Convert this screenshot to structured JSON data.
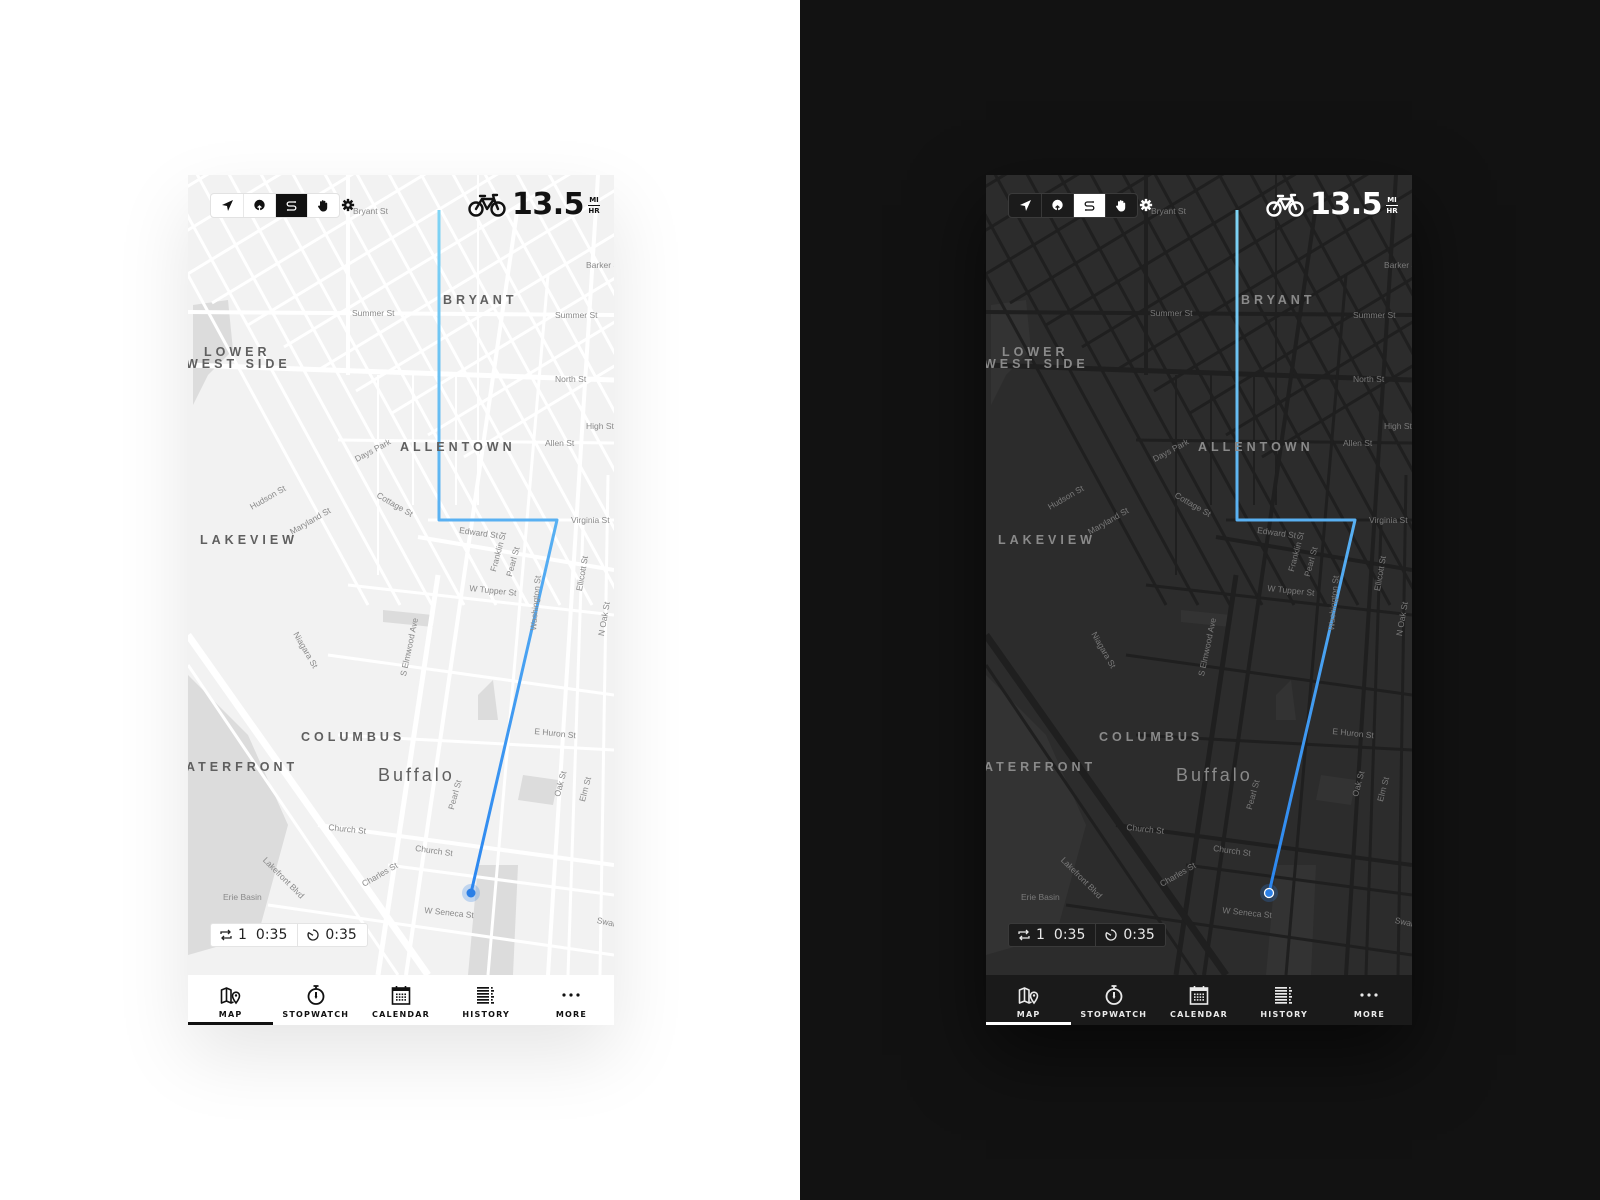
{
  "colors": {
    "route_start": "#7fd4f4",
    "route_end": "#2b86f0",
    "location_dot": "#2b7fe6",
    "light_map_bg": "#f2f2f2",
    "dark_map_bg": "#2c2c2c",
    "light_page_bg": "#ffffff",
    "dark_page_bg": "#121212"
  },
  "toolbar": {
    "modes": [
      {
        "name": "navigate",
        "icon": "navigation-arrow-icon",
        "active": false
      },
      {
        "name": "route",
        "icon": "tree-pin-icon",
        "active": false
      },
      {
        "name": "segments",
        "icon": "route-s-icon",
        "active": true
      },
      {
        "name": "pan",
        "icon": "hand-icon",
        "active": false
      }
    ],
    "settings_icon": "gear-icon"
  },
  "speed": {
    "icon": "bicycle-icon",
    "value": "13.5",
    "unit_top": "MI",
    "unit_bottom": "HR"
  },
  "timer": {
    "laps_icon": "repeat-icon",
    "laps": "1",
    "lap_time": "0:35",
    "stopwatch_icon": "timer-icon",
    "total_time": "0:35"
  },
  "nav": {
    "items": [
      {
        "label": "MAP",
        "icon": "map-pin-icon",
        "active": true
      },
      {
        "label": "STOPWATCH",
        "icon": "stopwatch-icon",
        "active": false
      },
      {
        "label": "CALENDAR",
        "icon": "calendar-icon",
        "active": false
      },
      {
        "label": "HISTORY",
        "icon": "list-icon",
        "active": false
      },
      {
        "label": "MORE",
        "icon": "more-dots-icon",
        "active": false
      }
    ]
  },
  "map": {
    "neighborhoods": [
      {
        "text": "BRYANT",
        "kind": "hood"
      },
      {
        "text": "LOWER",
        "kind": "hood"
      },
      {
        "text": "WEST SIDE",
        "kind": "hood"
      },
      {
        "text": "ALLENTOWN",
        "kind": "hood"
      },
      {
        "text": "LAKEVIEW",
        "kind": "hood"
      },
      {
        "text": "COLUMBUS",
        "kind": "hood"
      },
      {
        "text": "ATERFRONT",
        "kind": "hood"
      },
      {
        "text": "Buffalo",
        "kind": "city"
      }
    ],
    "streets": [
      "Bryant St",
      "Summer St",
      "Summer St",
      "North St",
      "Allen St",
      "Virginia St",
      "Edward St",
      "W Tupper St",
      "E Huron St",
      "Church St",
      "Church St",
      "W Seneca St",
      "High St",
      "Barker St",
      "Days Park",
      "Cottage St",
      "Hudson St",
      "Maryland St",
      "Pearl St",
      "Pearl St",
      "Franklin St",
      "Washington St",
      "Ellicott St",
      "Oak St",
      "Elm St",
      "N Oak St",
      "Niagara St",
      "Lakefront Blvd",
      "Charles St",
      "S Elmwood Ave",
      "Swan St",
      "Erie Basin"
    ]
  }
}
